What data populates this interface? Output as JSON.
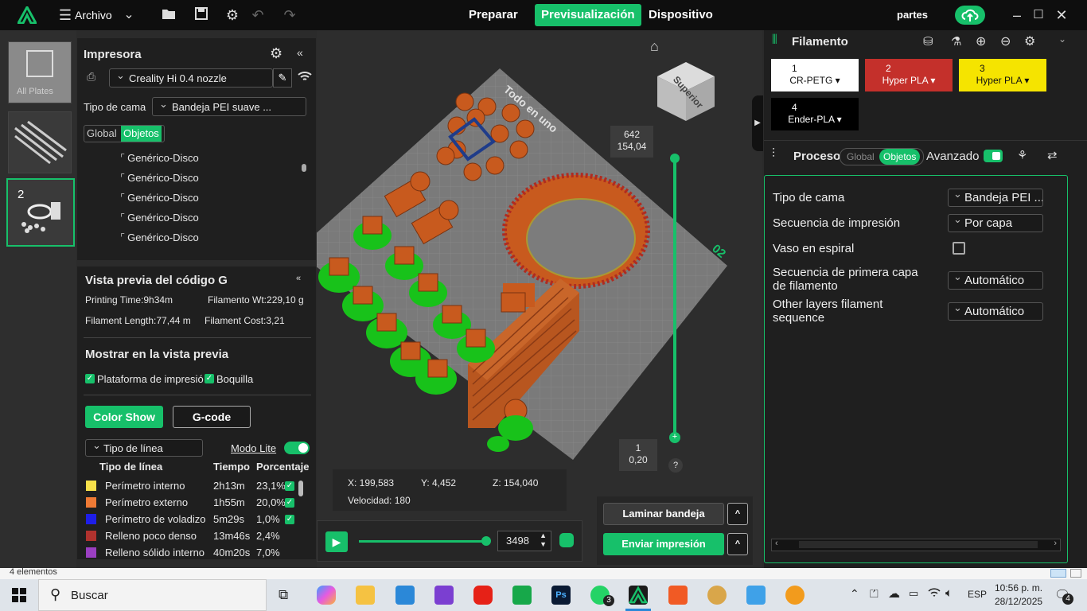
{
  "topbar": {
    "menu_label": "Archivo",
    "tabs": [
      "Preparar",
      "Previsualización",
      "Dispositivo"
    ],
    "active_tab": "Previsualización",
    "project_name": "partes",
    "accent": "#17c06a"
  },
  "plates": {
    "all_plates_label": "All Plates",
    "plate2_number": "2"
  },
  "printer": {
    "title": "Impresora",
    "printer_name": "Creality Hi 0.4 nozzle",
    "bed_type_label": "Tipo de cama",
    "bed_type_value": "Bandeja PEI suave ...",
    "toggle_global": "Global",
    "toggle_objects": "Objetos",
    "objects": [
      "Genérico-Disco",
      "Genérico-Disco",
      "Genérico-Disco",
      "Genérico-Disco",
      "Genérico-Disco"
    ]
  },
  "gcode_preview": {
    "title": "Vista previa del código G",
    "printing_time": "Printing Time:9h34m",
    "filament_wt": "Filamento Wt:229,10 g",
    "filament_length": "Filament Length:77,44 m",
    "filament_cost": "Filament Cost:3,21",
    "show_title": "Mostrar en la vista previa",
    "opt_platform": "Plataforma de impresió",
    "opt_nozzle": "Boquilla",
    "btn_color_show": "Color Show",
    "btn_gcode": "G-code",
    "line_type_dropdown": "Tipo de línea",
    "lite_mode": "Modo Lite",
    "col_type": "Tipo de línea",
    "col_time": "Tiempo",
    "col_pct": "Porcentaje",
    "rows": [
      {
        "name": "Perímetro interno",
        "time": "2h13m",
        "pct": "23,1%",
        "color": "#f7e04a"
      },
      {
        "name": "Perímetro externo",
        "time": "1h55m",
        "pct": "20,0%",
        "color": "#ef7a35"
      },
      {
        "name": "Perímetro de voladizo",
        "time": "5m29s",
        "pct": "1,0%",
        "color": "#1e1ee8"
      },
      {
        "name": "Relleno poco denso",
        "time": "13m46s",
        "pct": "2,4%",
        "color": "#b0322e"
      },
      {
        "name": "Relleno sólido interno",
        "time": "40m20s",
        "pct": "7,0%",
        "color": "#9b3fc2"
      }
    ]
  },
  "viewport": {
    "plate_label": "Todo en uno",
    "plate_number": "02",
    "view_cube_label": "Superior",
    "layer_top_count": "642",
    "layer_top_height": "154,04",
    "layer_bottom_count": "1",
    "layer_bottom_height": "0,20",
    "coord_x": "X: 199,583",
    "coord_y": "Y: 4,452",
    "coord_z": "Z: 154,040",
    "speed": "Velocidad: 180",
    "move_value": "3498",
    "help": "?"
  },
  "actions": {
    "slice": "Laminar bandeja",
    "print": "Enviar impresión"
  },
  "filament": {
    "title": "Filamento",
    "slots": [
      {
        "num": "1",
        "name": "CR-PETG",
        "bg": "#ffffff",
        "fg": "#111111"
      },
      {
        "num": "2",
        "name": "Hyper PLA",
        "bg": "#c4302b",
        "fg": "#ffffff"
      },
      {
        "num": "3",
        "name": "Hyper PLA",
        "bg": "#f5e400",
        "fg": "#111111"
      },
      {
        "num": "4",
        "name": "Ender-PLA",
        "bg": "#000000",
        "fg": "#ffffff"
      }
    ]
  },
  "process": {
    "title": "Proceso",
    "toggle_global": "Global",
    "toggle_objects": "Objetos",
    "advanced": "Avanzado",
    "rows": [
      {
        "label": "Tipo de cama",
        "value": "Bandeja PEI ..."
      },
      {
        "label": "Secuencia de impresión",
        "value": "Por capa"
      },
      {
        "label": "Vaso en espiral",
        "value": ""
      },
      {
        "label": "Secuencia de primera capa de filamento",
        "value": "Automático"
      },
      {
        "label": "Other layers filament sequence",
        "value": "Automático"
      }
    ]
  },
  "statusbar": {
    "items": "4 elementos"
  },
  "taskbar": {
    "search": "Buscar",
    "lang": "ESP",
    "time": "10:56 p. m.",
    "date": "28/12/2025",
    "whatsapp_badge": "3",
    "notif_badge": "4"
  }
}
